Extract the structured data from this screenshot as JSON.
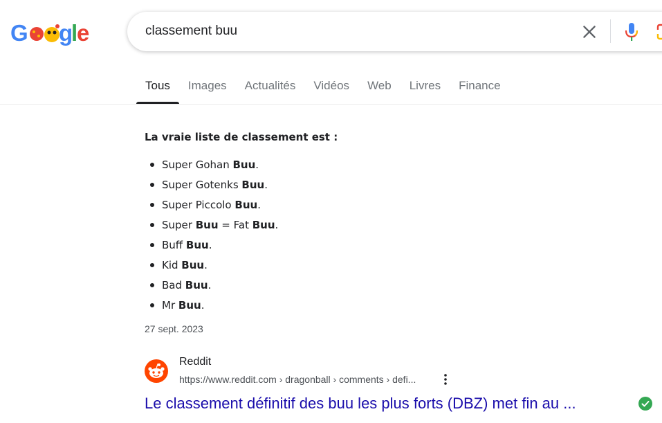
{
  "header": {
    "search": {
      "value": "classement buu",
      "placeholder": ""
    }
  },
  "tabs": [
    {
      "label": "Tous",
      "active": true
    },
    {
      "label": "Images"
    },
    {
      "label": "Actualités"
    },
    {
      "label": "Vidéos"
    },
    {
      "label": "Web"
    },
    {
      "label": "Livres"
    },
    {
      "label": "Finance"
    }
  ],
  "snippet": {
    "heading": "La vraie liste de classement est :",
    "items": [
      {
        "pre": "Super Gohan ",
        "bold": "Buu",
        "mid": "",
        "bold2": "",
        "post": "."
      },
      {
        "pre": "Super Gotenks ",
        "bold": "Buu",
        "mid": "",
        "bold2": "",
        "post": "."
      },
      {
        "pre": "Super Piccolo ",
        "bold": "Buu",
        "mid": "",
        "bold2": "",
        "post": "."
      },
      {
        "pre": "Super ",
        "bold": "Buu",
        "mid": " = Fat ",
        "bold2": "Buu",
        "post": "."
      },
      {
        "pre": "Buff ",
        "bold": "Buu",
        "mid": "",
        "bold2": "",
        "post": "."
      },
      {
        "pre": "Kid ",
        "bold": "Buu",
        "mid": "",
        "bold2": "",
        "post": "."
      },
      {
        "pre": "Bad ",
        "bold": "Buu",
        "mid": "",
        "bold2": "",
        "post": "."
      },
      {
        "pre": "Mr ",
        "bold": "Buu",
        "mid": "",
        "bold2": "",
        "post": "."
      }
    ],
    "date": "27 sept. 2023"
  },
  "result": {
    "source": "Reddit",
    "url": "https://www.reddit.com › dragonball › comments › defi...",
    "title": "Le classement définitif des buu les plus forts (DBZ) met fin au ..."
  },
  "colors": {
    "link": "#1a0dab",
    "reddit": "#ff4500",
    "verified": "#34a853"
  },
  "icons": {
    "logo": "google-doodle-logo",
    "clear": "close-icon",
    "mic": "microphone-icon",
    "lens": "camera-lens-icon",
    "more": "more-vert-icon",
    "source": "reddit-icon",
    "verified": "check-circle-icon"
  }
}
